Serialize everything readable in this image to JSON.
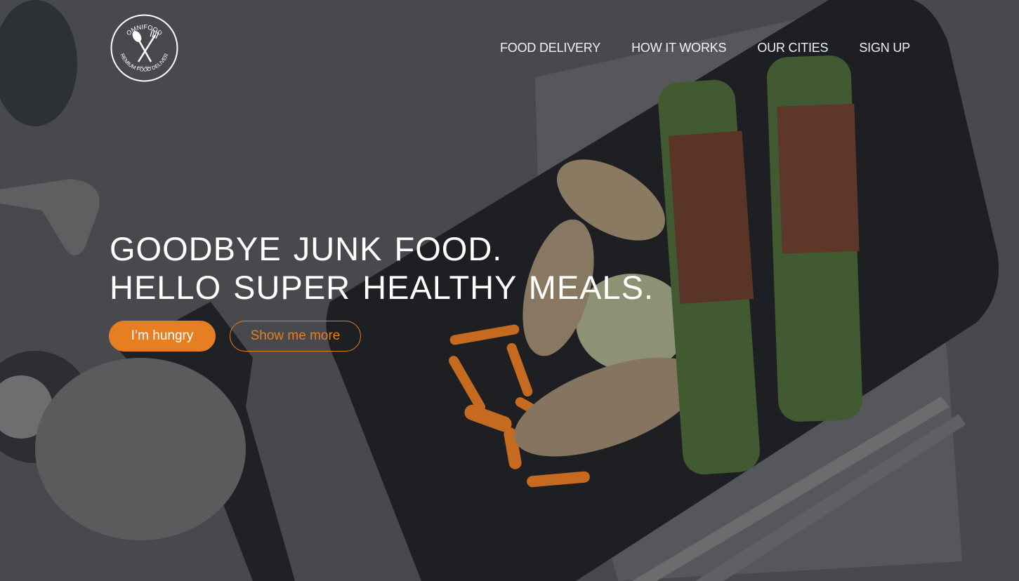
{
  "brand": {
    "name": "OMNIFOOD",
    "tagline": "PREMIUM FOOD DELIVERY",
    "est": "EST. 2014",
    "logo_icon": "spoon-fork-crossed-icon"
  },
  "nav": {
    "items": [
      {
        "label": "FOOD DELIVERY"
      },
      {
        "label": "HOW IT WORKS"
      },
      {
        "label": "OUR CITIES"
      },
      {
        "label": "SIGN UP"
      }
    ]
  },
  "hero": {
    "headline_line1": "GOODBYE JUNK FOOD.",
    "headline_line2": "HELLO SUPER HEALTHY MEALS.",
    "primary_button": "I’m hungry",
    "secondary_button": "Show me more",
    "background_image": "plate of chicken, carrots, leeks and prosciutto-wrapped asparagus"
  },
  "colors": {
    "accent": "#e67e22",
    "text": "#ffffff",
    "overlay_bg": "#46484b"
  }
}
